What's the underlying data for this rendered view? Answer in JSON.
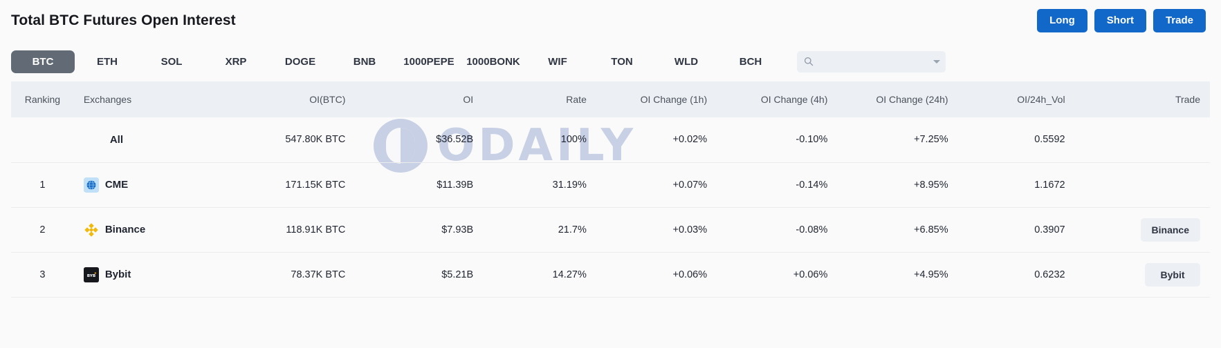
{
  "header": {
    "title": "Total BTC Futures Open Interest",
    "accent_color": "#1168c9",
    "buttons": [
      {
        "label": "Long",
        "name": "long-button"
      },
      {
        "label": "Short",
        "name": "short-button"
      },
      {
        "label": "Trade",
        "name": "trade-button"
      }
    ]
  },
  "tabs": {
    "active": "BTC",
    "items": [
      "BTC",
      "ETH",
      "SOL",
      "XRP",
      "DOGE",
      "BNB",
      "1000PEPE",
      "1000BONK",
      "WIF",
      "TON",
      "WLD",
      "BCH"
    ]
  },
  "search": {
    "placeholder": "",
    "value": "",
    "icon": "search-icon",
    "dropdown_icon": "chevron-down-icon"
  },
  "watermark": {
    "text": "ODAILY",
    "color": "#9aabd0"
  },
  "table": {
    "columns": [
      "Ranking",
      "Exchanges",
      "OI(BTC)",
      "OI",
      "Rate",
      "OI Change (1h)",
      "OI Change (4h)",
      "OI Change (24h)",
      "OI/24h_Vol",
      "Trade"
    ],
    "rows": [
      {
        "ranking": "",
        "exchange": "All",
        "icon": "",
        "oi_btc": "547.80K BTC",
        "oi": "$36.52B",
        "rate": "100%",
        "change_1h": "+0.02%",
        "change_1h_dir": "pos",
        "change_4h": "-0.10%",
        "change_4h_dir": "neg",
        "change_24h": "+7.25%",
        "change_24h_dir": "pos",
        "oi_vol": "0.5592",
        "trade": ""
      },
      {
        "ranking": "1",
        "exchange": "CME",
        "icon": "cme-icon",
        "oi_btc": "171.15K BTC",
        "oi": "$11.39B",
        "rate": "31.19%",
        "change_1h": "+0.07%",
        "change_1h_dir": "pos",
        "change_4h": "-0.14%",
        "change_4h_dir": "neg",
        "change_24h": "+8.95%",
        "change_24h_dir": "pos",
        "oi_vol": "1.1672",
        "trade": ""
      },
      {
        "ranking": "2",
        "exchange": "Binance",
        "icon": "binance-icon",
        "oi_btc": "118.91K BTC",
        "oi": "$7.93B",
        "rate": "21.7%",
        "change_1h": "+0.03%",
        "change_1h_dir": "pos",
        "change_4h": "-0.08%",
        "change_4h_dir": "neg",
        "change_24h": "+6.85%",
        "change_24h_dir": "pos",
        "oi_vol": "0.3907",
        "trade": "Binance"
      },
      {
        "ranking": "3",
        "exchange": "Bybit",
        "icon": "bybit-icon",
        "oi_btc": "78.37K BTC",
        "oi": "$5.21B",
        "rate": "14.27%",
        "change_1h": "+0.06%",
        "change_1h_dir": "pos",
        "change_4h": "+0.06%",
        "change_4h_dir": "pos",
        "change_24h": "+4.95%",
        "change_24h_dir": "pos",
        "oi_vol": "0.6232",
        "trade": "Bybit"
      }
    ]
  }
}
